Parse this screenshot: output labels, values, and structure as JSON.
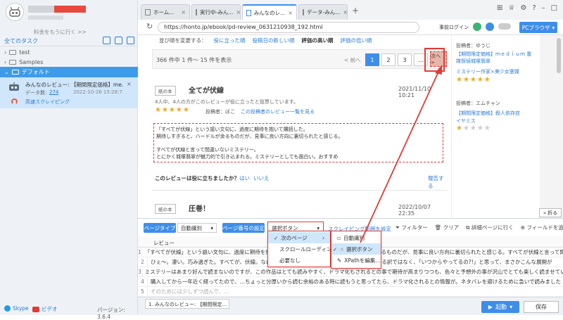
{
  "sidebar": {
    "upgrade_link": "料金をもうに行く >>",
    "section_title": "全てのタスク",
    "folders": [
      "test",
      "Samples",
      "デフォルト"
    ],
    "task": {
      "name": "みんなのレビュー: 【期間限定価格】me...",
      "count_label": "データ数:",
      "count": "274",
      "date": "2022-10-26 15:28:7",
      "mode": "高速スクレイピング"
    },
    "skype": "Skype",
    "video": "ビデオ",
    "version": "バージョン: 3.6.4"
  },
  "tabs": [
    {
      "label": "ホーム..."
    },
    {
      "label": "実行中-みん..."
    },
    {
      "label": "みんなのレ..."
    },
    {
      "label": "データ-みん..."
    }
  ],
  "url": "https://honto.jp/ebook/pd-review_0631210938_192.html",
  "url_right": {
    "login": "事前ログイン",
    "browser": "PCブラウザ"
  },
  "content": {
    "sort_label": "並び順を変更する：",
    "sort_options": [
      "役に立った順",
      "投稿日の新しい順",
      "評価の高い順",
      "評価の低い順"
    ],
    "result_count": "366 件中 1 件～ 15 件を表示",
    "pager": {
      "prev": "< 前へ",
      "pages": [
        "1",
        "2",
        "3",
        "..."
      ],
      "next": "次へ >"
    },
    "review1": {
      "badge": "紙の本",
      "title": "全てが伏線",
      "date": "2021/11/10 10:21",
      "helpful": "4人中、4人の方がこのレビューが役に立ったと投票しています。",
      "author_label": "投稿者：ぼこ",
      "author_link": "この投稿者のレビュー一覧を見る",
      "body1": "「すべてが伏線」という謳い文句に、過度に期待を抱いて購読した。",
      "body2": "期待しすぎると、ハードルが余るものだが、見事に良い方向に裏切られたと感じる。",
      "body3": "すべてが伏線と言って間違いないミステリー。",
      "body4": "とにかく城塚翡翠が魅力的で引き込まれる。ミステリーとしても面白い。おすすめ",
      "vote_question": "このレビューは役に立ちましたか？",
      "vote_yes": "はい",
      "vote_no": "いいえ",
      "report": "報告する"
    },
    "review2": {
      "badge": "紙の本",
      "title": "圧巻！",
      "date": "2022/10/07 22:35"
    }
  },
  "rightcol": {
    "item1_author": "投稿者：ゆうじ",
    "item1_title": "【期間限定価格】ｍｅｄｉｕｍ 霊媒探偵城塚翡翠",
    "item1_sub": "ミステリー作家×美少女霊媒",
    "item2_author": "投稿者：エムチャン",
    "item2_title": "【期間限定価格】殺人依存症",
    "item2_sub": "イヤミス",
    "collapse": "折る"
  },
  "bottom": {
    "page_type_label": "ページタイプ",
    "page_type_value": "自動識別",
    "page_setting_label": "ページ番号の設定",
    "page_setting_value": "選択ボタン",
    "scrape_scope": "スクレイピング範囲を設定",
    "filter": "フィルター",
    "clear": "クリア",
    "detail": "詳細ページに行く",
    "add_field": "フィールドを追加",
    "column_header": "レビュー",
    "rows": [
      "「すべてが伏線」という謳い文句に、過度に期待を抱いて購読した。期待しすぎると、ハードルが余るものだが、見事に良い方向に裏切られたと感じる。すべてが伏線と言って間違いない",
      "ひぇ～。凄い。巧み過ぎた。すべてが、伏線。なのは帯通り、読後「あー、そういうことね」となる訳ではなく、「いつからやってるの?!」と思って、まさかこんな展開が",
      "ミステリーはあまり好んで読まないのですが、この作品はとても読みやすく、ドラマ化もされるとの事で期待が高まりつつも、色々と予想外の事が沢山でとても楽しく読ませていただきました",
      "購入してから一年近く経ってたので、…ちょっと分厚いから読む余裕のある時に読もうと思ってたら、ドラマ化されるとの情報が。ネタバレを避けるために急いで読みました",
      "そのためには少しずつ読んで、…"
    ]
  },
  "menu": {
    "items": [
      "次のページ",
      "スクロールローディング",
      "必要なし"
    ],
    "sub_items": [
      "自動識別",
      "選択ボタン",
      "XPathを編集..."
    ]
  },
  "footer": {
    "task_tab": "1. みんなのレビュー: 【期間限定...",
    "start": "起動",
    "save": "保存"
  },
  "colors": {
    "accent": "#3e8ee8",
    "highlight": "#cfe6fb",
    "red": "#e53935",
    "star": "#f5a623"
  }
}
